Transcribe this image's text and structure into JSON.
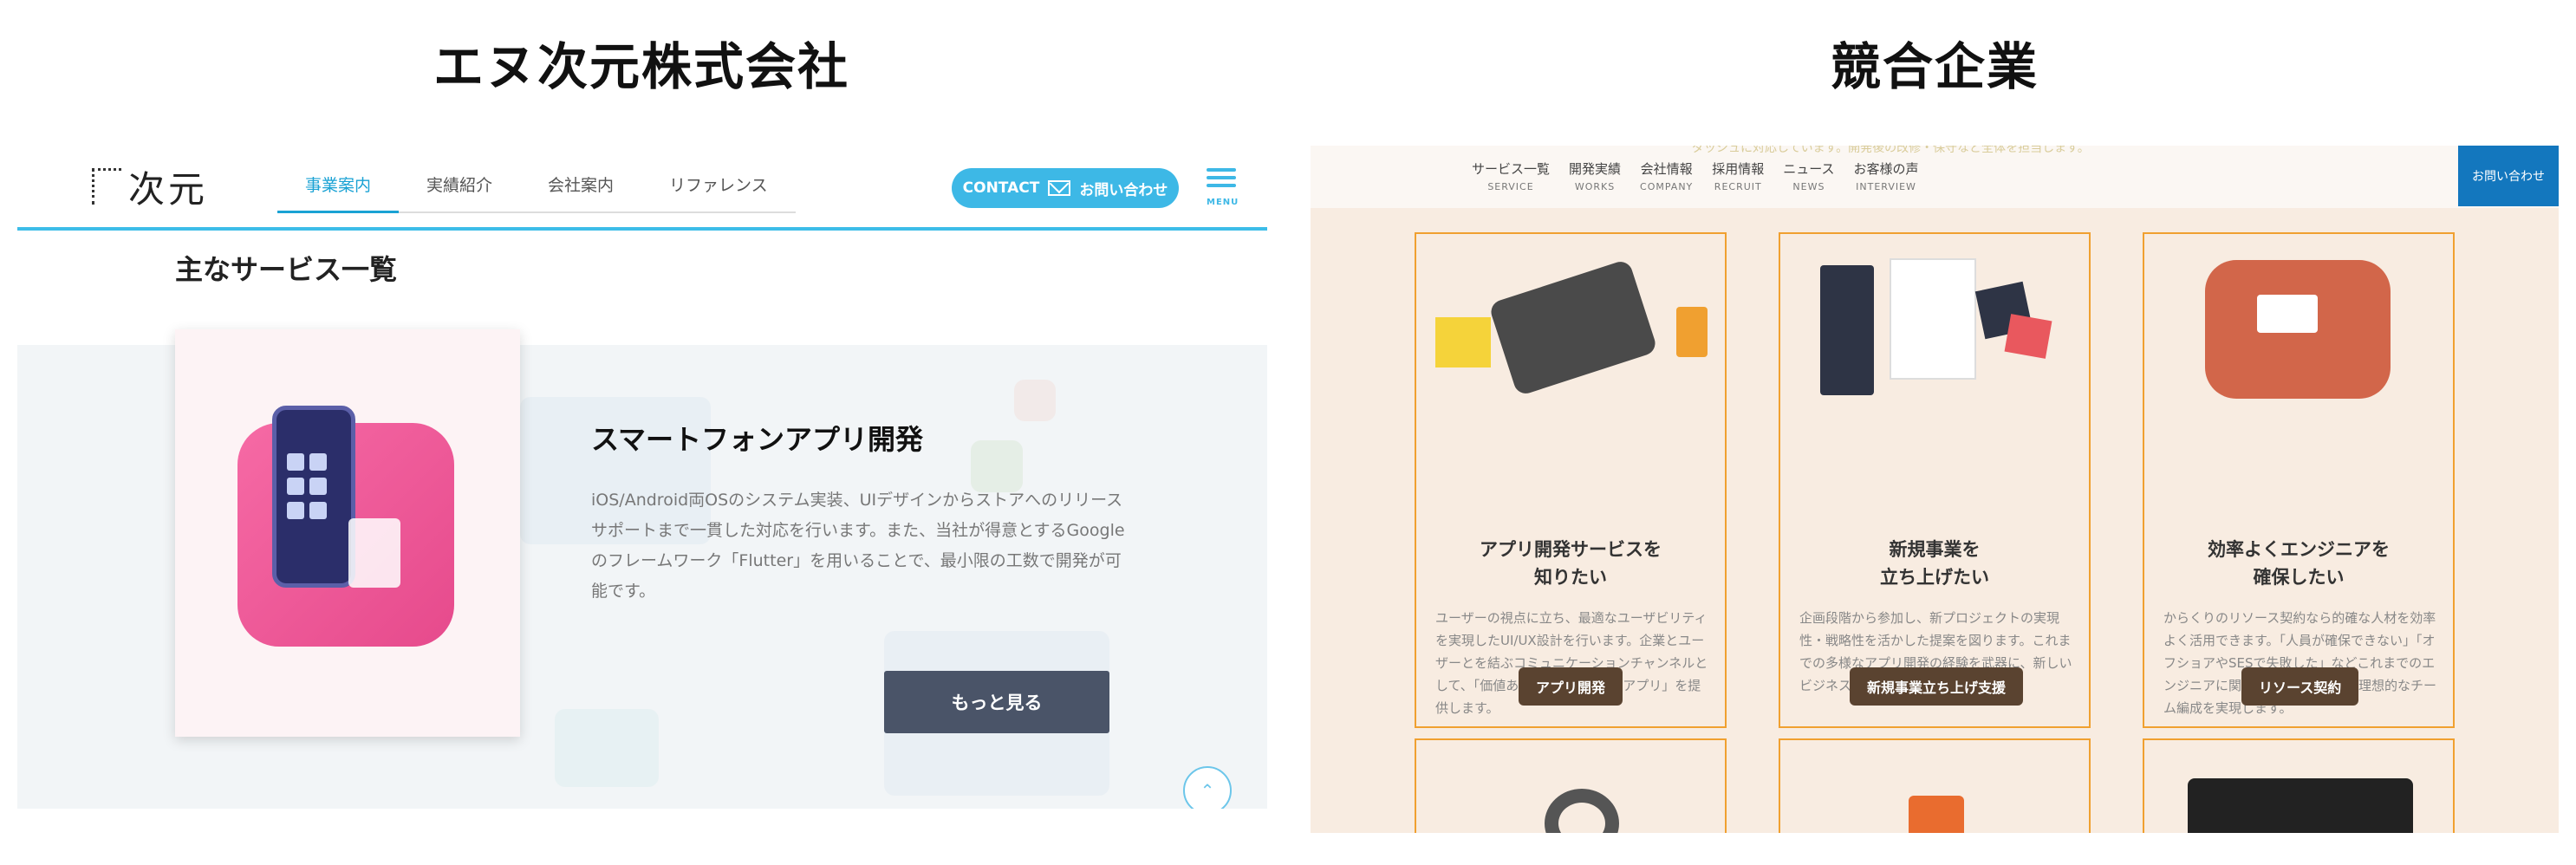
{
  "headings": {
    "left": "エヌ次元株式会社",
    "right": "競合企業"
  },
  "left": {
    "logo": "次元",
    "nav": [
      "事業案内",
      "実績紹介",
      "会社案内",
      "リファレンス"
    ],
    "contact": {
      "label_en": "CONTACT",
      "label_jp": "お問い合わせ"
    },
    "menu_label": "MENU",
    "section_title": "主なサービス一覧",
    "service": {
      "title": "スマートフォンアプリ開発",
      "desc": "iOS/Android両OSのシステム実装、UIデザインからストアへのリリースサポートまで一貫した対応を行います。また、当社が得意とするGoogleのフレームワーク「Flutter」を用いることで、最小限の工数で開発が可能です。",
      "button": "もっと見る"
    },
    "colors": {
      "accent": "#3db8e6",
      "button": "#4a5468",
      "illustration": "#f66aa5"
    }
  },
  "right": {
    "top_text": "ダッシュに対応しています。開発後の改修・保守など全体を担当します。",
    "nav": [
      {
        "jp": "サービス一覧",
        "en": "SERVICE"
      },
      {
        "jp": "開発実績",
        "en": "WORKS"
      },
      {
        "jp": "会社情報",
        "en": "COMPANY"
      },
      {
        "jp": "採用情報",
        "en": "RECRUIT"
      },
      {
        "jp": "ニュース",
        "en": "NEWS"
      },
      {
        "jp": "お客様の声",
        "en": "INTERVIEW"
      }
    ],
    "contact": "お問い合わせ",
    "cards": [
      {
        "title": "アプリ開発サービスを\n知りたい",
        "desc": "ユーザーの視点に立ち、最適なユーザビリティを実現したUI/UX設計を行います。企業とユーザーとを結ぶコミュニケーションチャンネルとして、「価値ある情報を伝達するアプリ」を提供します。",
        "button": "アプリ開発"
      },
      {
        "title": "新規事業を\n立ち上げたい",
        "desc": "企画段階から参加し、新プロジェクトの実現性・戦略性を活かした提案を図ります。これまでの多様なアプリ開発の経験を武器に、新しいビジネスへの挑戦をサポートします。",
        "button": "新規事業立ち上げ支援"
      },
      {
        "title": "効率よくエンジニアを\n確保したい",
        "desc": "からくりのリソース契約なら的確な人材を効率よく活用できます。「人員が確保できない」「オフショアやSESで失敗した」などこれまでのエンジニアに関する問題を解決し、理想的なチーム編成を実現します。",
        "button": "リソース契約"
      }
    ],
    "colors": {
      "border": "#f0a030",
      "button": "#5a4330",
      "background": "#f8ece1",
      "contact": "#1377be"
    }
  }
}
